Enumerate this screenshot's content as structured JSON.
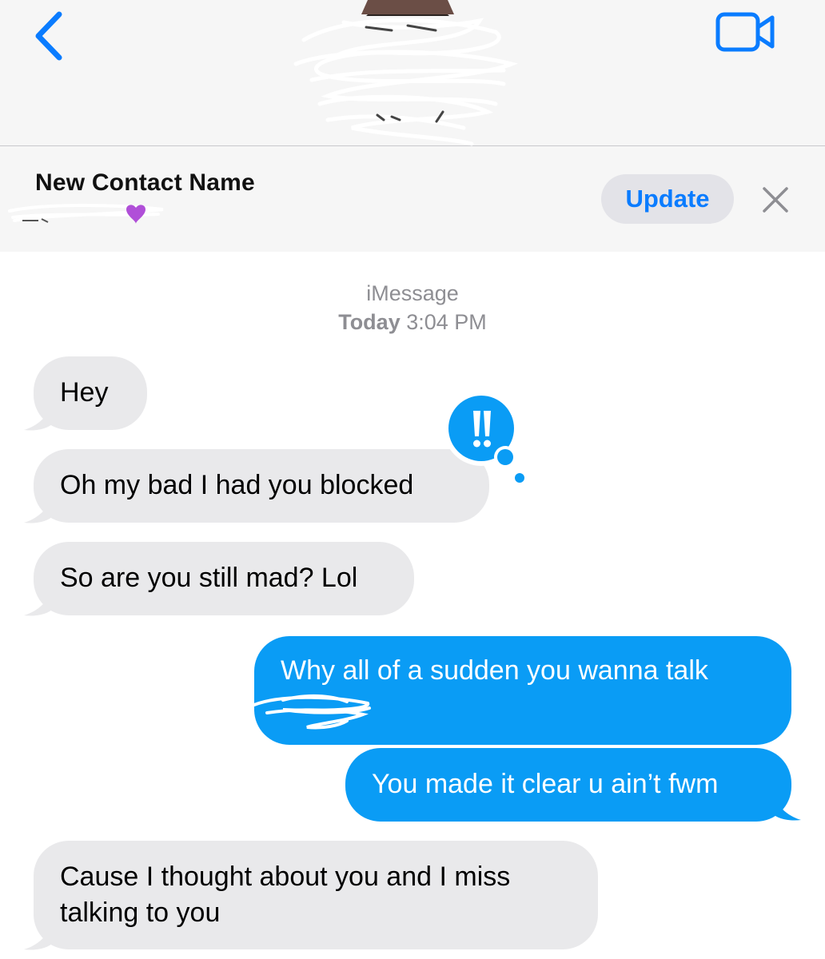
{
  "header": {
    "back_icon": "chevron-left-icon",
    "video_icon": "video-camera-icon",
    "accent_color": "#0a7cff"
  },
  "banner": {
    "title": "New Contact Name",
    "update_label": "Update",
    "close_icon": "close-x-icon"
  },
  "conversation": {
    "service": "iMessage",
    "timestamp_day": "Today",
    "timestamp_time": "3:04 PM"
  },
  "messages": [
    {
      "from": "them",
      "text": "Hey"
    },
    {
      "from": "them",
      "text": "Oh my bad I had you blocked",
      "tapback": "!!"
    },
    {
      "from": "them",
      "text": "So are you still mad? Lol"
    },
    {
      "from": "me",
      "text": "Why all of a sudden you wanna talk"
    },
    {
      "from": "me",
      "text": "You made it clear u ain’t fwm"
    },
    {
      "from": "them",
      "text": "Cause I thought about you and I miss",
      "text2": "talking to you"
    }
  ],
  "colors": {
    "incoming_bubble": "#e9e9eb",
    "outgoing_bubble": "#0a9cf5",
    "tapback": "#0a9cf5"
  }
}
